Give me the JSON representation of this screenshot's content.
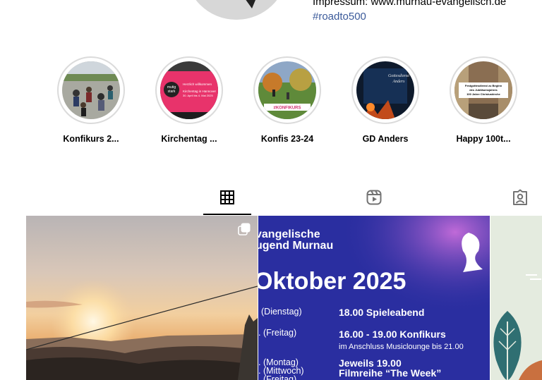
{
  "profile": {
    "bio_impressum": "Impressum: www.murnau-evangelisch.de",
    "bio_hashtag": "#roadto500"
  },
  "highlights": [
    {
      "label": "Konfikurs 2..."
    },
    {
      "label": "Kirchentag ..."
    },
    {
      "label": "Konfis 23-24",
      "sticker": "#KONFIKURS"
    },
    {
      "label": "GD Anders",
      "cover_text_1": "Gottesdienst",
      "cover_text_2": "Anders"
    },
    {
      "label": "Happy 100t...",
      "cover_text_1": "Festgottesdienst zu Beginn",
      "cover_text_2": "des Jubiläumsjahres",
      "cover_text_3": "100 Jahre Christuskirche"
    }
  ],
  "kirchentag_cover": {
    "line1": "Herzlich willkommen",
    "line2": "Kirchentag in Hannover",
    "line3": "30. April bis 4. Mai 2025"
  },
  "tabs": [
    {
      "name": "posts",
      "icon": "grid-icon",
      "active": true
    },
    {
      "name": "reels",
      "icon": "reels-icon",
      "active": false
    },
    {
      "name": "tagged",
      "icon": "tagged-icon",
      "active": false
    }
  ],
  "posts": {
    "post2": {
      "title1": "vangelische",
      "title2": "ugend Murnau",
      "month": "Oktober 2025",
      "rows": [
        {
          "day": "(Dienstag)",
          "event": "18.00 Spieleabend",
          "sub": ""
        },
        {
          "day": ". (Freitag)",
          "event": "16.00 - 19.00 Konfikurs",
          "sub": "im Anschluss Musiclounge bis 21.00"
        },
        {
          "day": ". (Montag)",
          "event": "Jeweils 19.00",
          "sub": ""
        },
        {
          "day": ". (Mittwoch)",
          "event": "Filmreihe “The Week”",
          "sub": ""
        },
        {
          "day": ". (Freitag)",
          "event": "",
          "sub": ""
        }
      ]
    }
  },
  "colors": {
    "accent_link": "#00376b",
    "post2_bg": "#2a2ea0",
    "tab_active": "#000000"
  }
}
